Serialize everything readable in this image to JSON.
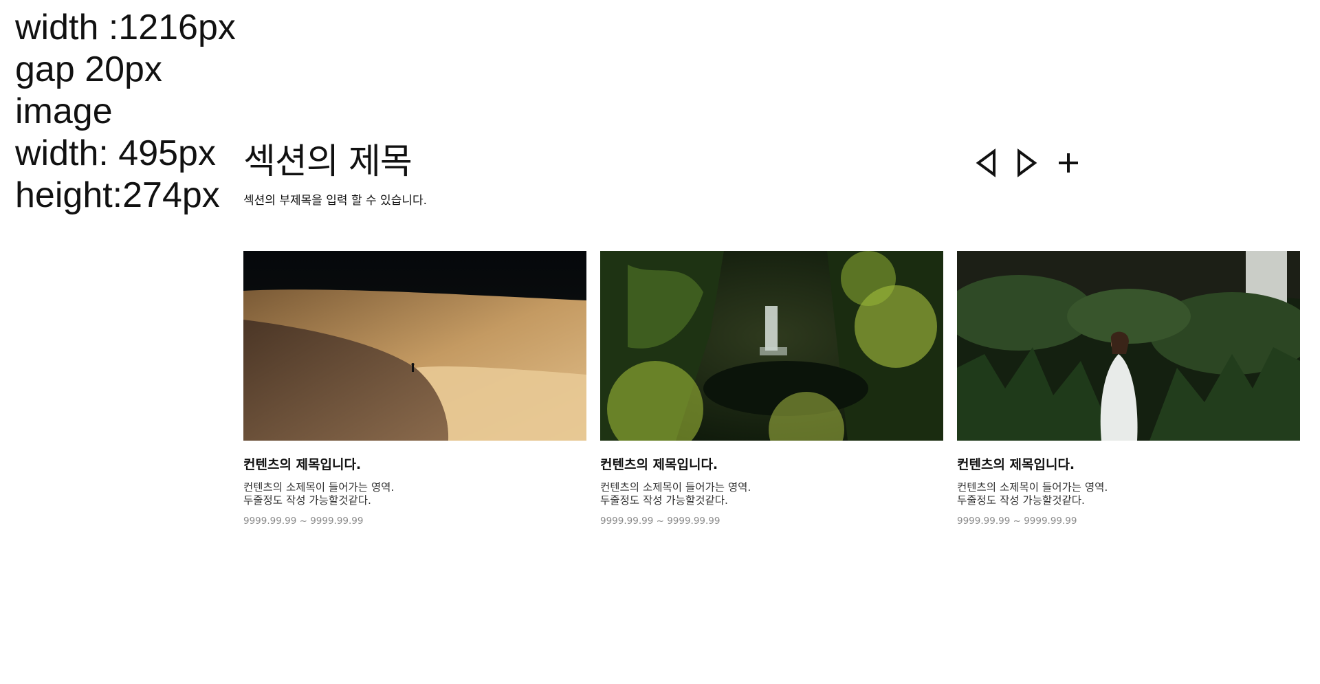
{
  "notes": {
    "width": "width :1216px",
    "gap": "gap 20px",
    "image_label": "image",
    "image_width": "width: 495px",
    "image_height": "height:274px"
  },
  "section": {
    "title": "섹션의 제목",
    "subtitle": "섹션의 부제목을 입력 할 수 있습니다.",
    "controls": [
      {
        "icon": "arrow-left-outline-icon"
      },
      {
        "icon": "arrow-right-outline-icon"
      },
      {
        "icon": "plus-icon"
      }
    ]
  },
  "cards": [
    {
      "image": "desert-dunes-photo",
      "title": "컨텐츠의 제목입니다.",
      "desc_line1": "컨텐츠의 소제목이 들어가는 영역.",
      "desc_line2": "두줄정도 작성 가능할것같다.",
      "date": "9999.99.99 ~ 9999.99.99"
    },
    {
      "image": "forest-waterfall-photo",
      "title": "컨텐츠의 제목입니다.",
      "desc_line1": "컨텐츠의 소제목이 들어가는 영역.",
      "desc_line2": "두줄정도 작성 가능할것같다.",
      "date": "9999.99.99 ~ 9999.99.99"
    },
    {
      "image": "woman-in-jungle-photo",
      "title": "컨텐츠의 제목입니다.",
      "desc_line1": "컨텐츠의 소제목이 들어가는 영역.",
      "desc_line2": "두줄정도 작성 가능할것같다.",
      "date": "9999.99.99 ~ 9999.99.99"
    }
  ],
  "colors": {
    "text": "#111111",
    "description": "#333333",
    "date": "#8a8a8a",
    "background": "#ffffff"
  }
}
